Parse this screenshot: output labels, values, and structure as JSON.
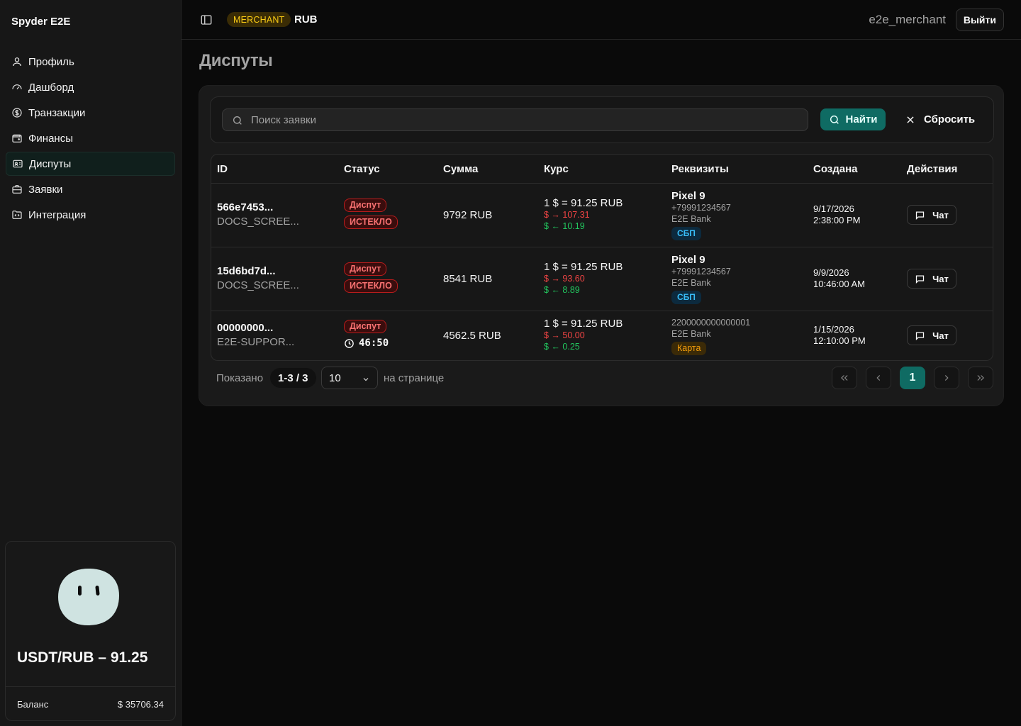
{
  "app": {
    "brand": "Spyder E2E"
  },
  "sidebar": {
    "items": [
      {
        "label": "Профиль",
        "icon": "user-icon"
      },
      {
        "label": "Дашборд",
        "icon": "gauge-icon"
      },
      {
        "label": "Транзакции",
        "icon": "dollar-circle-icon"
      },
      {
        "label": "Финансы",
        "icon": "wallet-icon"
      },
      {
        "label": "Диспуты",
        "icon": "ticket-icon",
        "active": true
      },
      {
        "label": "Заявки",
        "icon": "briefcase-icon"
      },
      {
        "label": "Интеграция",
        "icon": "folder-code-icon"
      }
    ],
    "rate_card": {
      "rate": "USDT/RUB – 91.25",
      "balance_label": "Баланс",
      "balance_value": "$ 35706.34"
    }
  },
  "header": {
    "role": "MERCHANT",
    "currency": "RUB",
    "username": "e2e_merchant",
    "logout": "Выйти"
  },
  "page": {
    "title": "Диспуты"
  },
  "search": {
    "placeholder": "Поиск заявки",
    "find": "Найти",
    "reset": "Сбросить"
  },
  "table": {
    "columns": [
      "ID",
      "Статус",
      "Сумма",
      "Курс",
      "Реквизиты",
      "Создана",
      "Действия"
    ],
    "rows": [
      {
        "id": "566e7453...",
        "ref": "DOCS_SCREE...",
        "status": "Диспут",
        "status2": "ИСТЕКЛО",
        "amount": "9792 RUB",
        "rate": "1 $ = 91.25 RUB",
        "rate_up": "$ → 107.31",
        "rate_down": "$ ← 10.19",
        "req_name": "Pixel 9",
        "req_line1": "+79991234567",
        "req_line2": "E2E Bank",
        "req_tag": "СБП",
        "date": "9/17/2026",
        "time": "2:38:00 PM",
        "action": "Чат"
      },
      {
        "id": "15d6bd7d...",
        "ref": "DOCS_SCREE...",
        "status": "Диспут",
        "status2": "ИСТЕКЛО",
        "amount": "8541 RUB",
        "rate": "1 $ = 91.25 RUB",
        "rate_up": "$ → 93.60",
        "rate_down": "$ ← 8.89",
        "req_name": "Pixel 9",
        "req_line1": "+79991234567",
        "req_line2": "E2E Bank",
        "req_tag": "СБП",
        "date": "9/9/2026",
        "time": "10:46:00 AM",
        "action": "Чат"
      },
      {
        "id": "00000000...",
        "ref": "E2E-SUPPOR...",
        "status": "Диспут",
        "timer": "46:50",
        "amount": "4562.5 RUB",
        "rate": "1 $ = 91.25 RUB",
        "rate_up": "$ → 50.00",
        "rate_down": "$ ← 0.25",
        "req_line1": "2200000000000001",
        "req_line2": "E2E Bank",
        "req_tag": "Карта",
        "date": "1/15/2026",
        "time": "12:10:00 PM",
        "action": "Чат"
      }
    ]
  },
  "pagination": {
    "shown_label": "Показано",
    "range": "1-3 / 3",
    "per_page": "10",
    "per_page_label": "на странице",
    "current_page": "1"
  }
}
